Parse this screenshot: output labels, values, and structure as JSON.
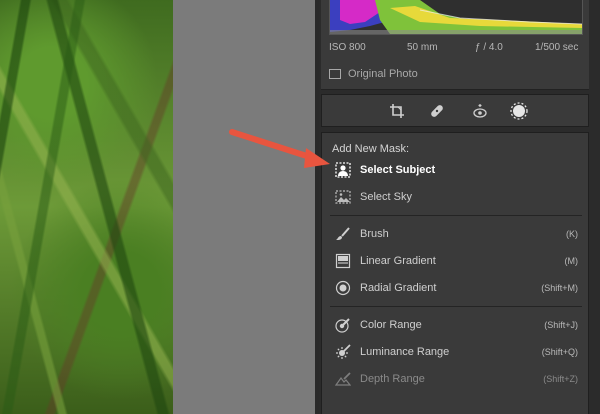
{
  "info": {
    "iso": "ISO 800",
    "focal": "50 mm",
    "aperture": "ƒ / 4.0",
    "shutter": "1/500 sec",
    "original_photo": "Original Photo"
  },
  "tools": [
    {
      "name": "crop-icon"
    },
    {
      "name": "healing-icon"
    },
    {
      "name": "red-eye-icon"
    },
    {
      "name": "masking-icon"
    }
  ],
  "mask": {
    "title": "Add New Mask:",
    "items": [
      {
        "label": "Select Subject",
        "key": ""
      },
      {
        "label": "Select Sky",
        "key": ""
      },
      {
        "label": "Brush",
        "key": "(K)"
      },
      {
        "label": "Linear Gradient",
        "key": "(M)"
      },
      {
        "label": "Radial Gradient",
        "key": "(Shift+M)"
      },
      {
        "label": "Color Range",
        "key": "(Shift+J)"
      },
      {
        "label": "Luminance Range",
        "key": "(Shift+Q)"
      },
      {
        "label": "Depth Range",
        "key": "(Shift+Z)"
      }
    ]
  },
  "colors": {
    "annotation_arrow": "#e8553f",
    "panel_bg": "#3a3a3a"
  }
}
